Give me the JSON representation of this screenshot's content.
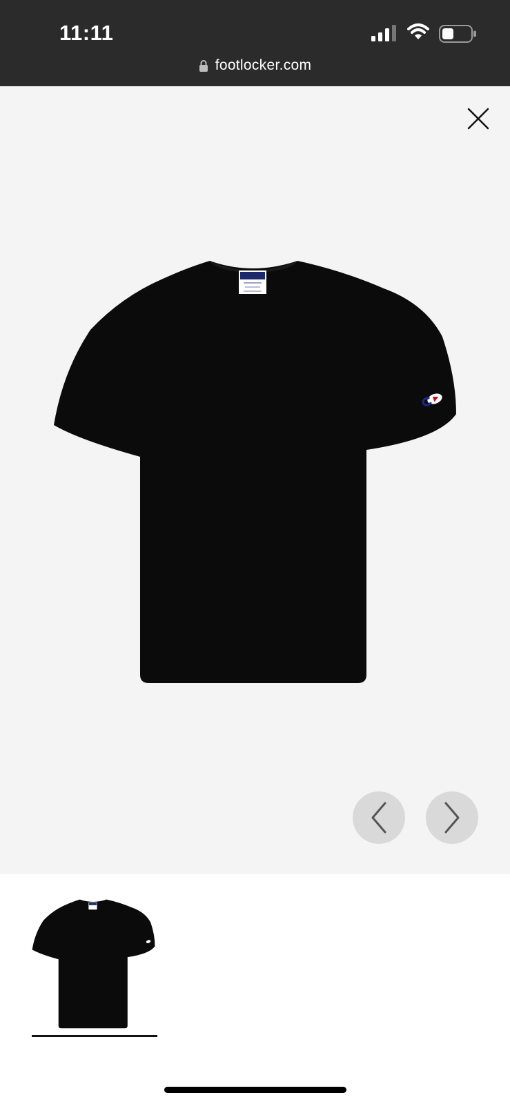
{
  "status_bar": {
    "time": "11:11",
    "url": "footlocker.com",
    "icons": [
      "signal-icon",
      "wifi-icon",
      "battery-icon",
      "lock-icon"
    ]
  },
  "viewer": {
    "close_icon": "close-icon",
    "prev_icon": "chevron-left-icon",
    "next_icon": "chevron-right-icon",
    "image_alt": "Black Champion t-shirt"
  },
  "thumbnails": {
    "selected_index": 0,
    "count": 1
  },
  "colors": {
    "status_bar_bg": "#2b2b2b",
    "viewer_bg": "#f4f4f4",
    "nav_button_bg": "#d9d9d9",
    "shirt": "#0b0b0b"
  }
}
